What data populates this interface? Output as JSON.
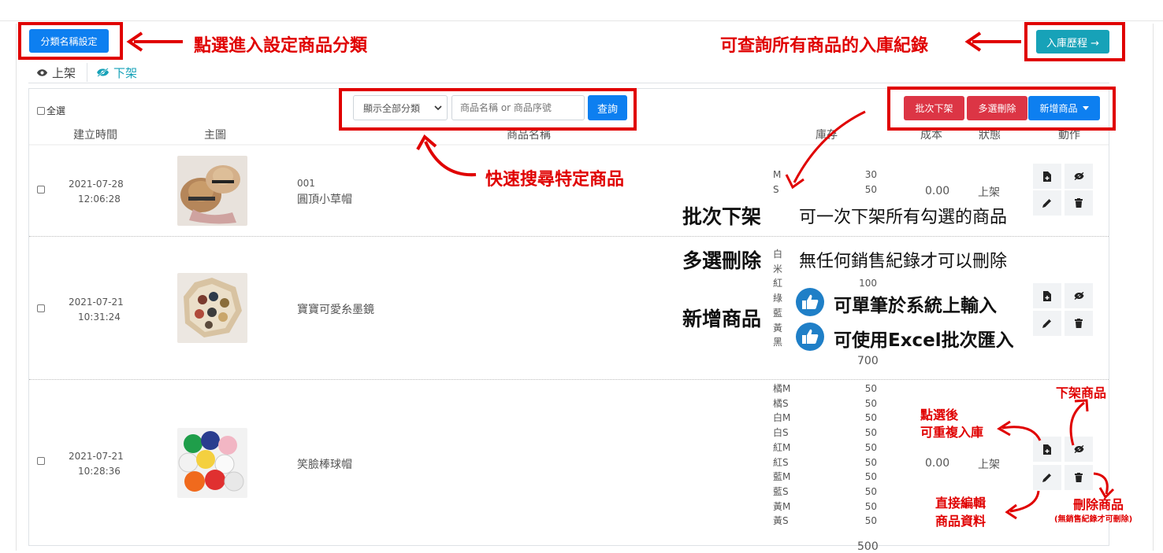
{
  "top_buttons": {
    "category_settings": "分類名稱設定",
    "inbound_history": "入庫歷程 →"
  },
  "tabs": {
    "on_shelf": "上架",
    "off_shelf": "下架"
  },
  "toolbar": {
    "select_all": "全選",
    "category_filter": "顯示全部分類",
    "search_placeholder": "商品名稱 or 商品序號",
    "search_button": "查詢",
    "batch_off_shelf": "批次下架",
    "multi_delete": "多選刪除",
    "add_product": "新增商品"
  },
  "columns": [
    "建立時間",
    "主圖",
    "商品名稱",
    "庫存",
    "成本",
    "狀態",
    "動作"
  ],
  "rows": [
    {
      "date": "2021-07-28",
      "time": "12:06:28",
      "sku": "001",
      "name": "圓頂小草帽",
      "stock": [
        [
          "M",
          "30"
        ],
        [
          "S",
          "50"
        ]
      ],
      "cost": "0.00",
      "status": "上架"
    },
    {
      "date": "2021-07-21",
      "time": "10:31:24",
      "sku": "",
      "name": "寶寶可愛糸墨鏡",
      "stock": [
        [
          "白",
          ""
        ],
        [
          "米",
          ""
        ],
        [
          "紅",
          "100"
        ],
        [
          "綠",
          ""
        ],
        [
          "藍",
          ""
        ],
        [
          "黃",
          ""
        ],
        [
          "黑",
          ""
        ]
      ],
      "stock_total": "700"
    },
    {
      "date": "2021-07-21",
      "time": "10:28:36",
      "sku": "",
      "name": "笑臉棒球帽",
      "stock": [
        [
          "橘M",
          "50"
        ],
        [
          "橘S",
          "50"
        ],
        [
          "白M",
          "50"
        ],
        [
          "白S",
          "50"
        ],
        [
          "紅M",
          "50"
        ],
        [
          "紅S",
          "50"
        ],
        [
          "藍M",
          "50"
        ],
        [
          "藍S",
          "50"
        ],
        [
          "黃M",
          "50"
        ],
        [
          "黃S",
          "50"
        ]
      ],
      "stock_total": "500",
      "cost": "0.00",
      "status": "上架"
    }
  ],
  "annotations": {
    "category": "點選進入設定商品分類",
    "history": "可查詢所有商品的入庫紀錄",
    "search": "快速搜尋特定商品",
    "batch_title": "批次下架",
    "batch_desc": "可一次下架所有勾選的商品",
    "delete_title": "多選刪除",
    "delete_desc": "無任何銷售紀錄才可以刪除",
    "add_title": "新增商品",
    "add_desc1": "可單筆於系統上輸入",
    "add_desc2": "可使用Excel批次匯入",
    "off_shelf_product": "下架商品",
    "reinbound_1": "點選後",
    "reinbound_2": "可重複入庫",
    "edit_1": "直接編輯",
    "edit_2": "商品資料",
    "delete_product": "刪除商品",
    "delete_note": "(無銷售紀錄才可刪除)"
  }
}
